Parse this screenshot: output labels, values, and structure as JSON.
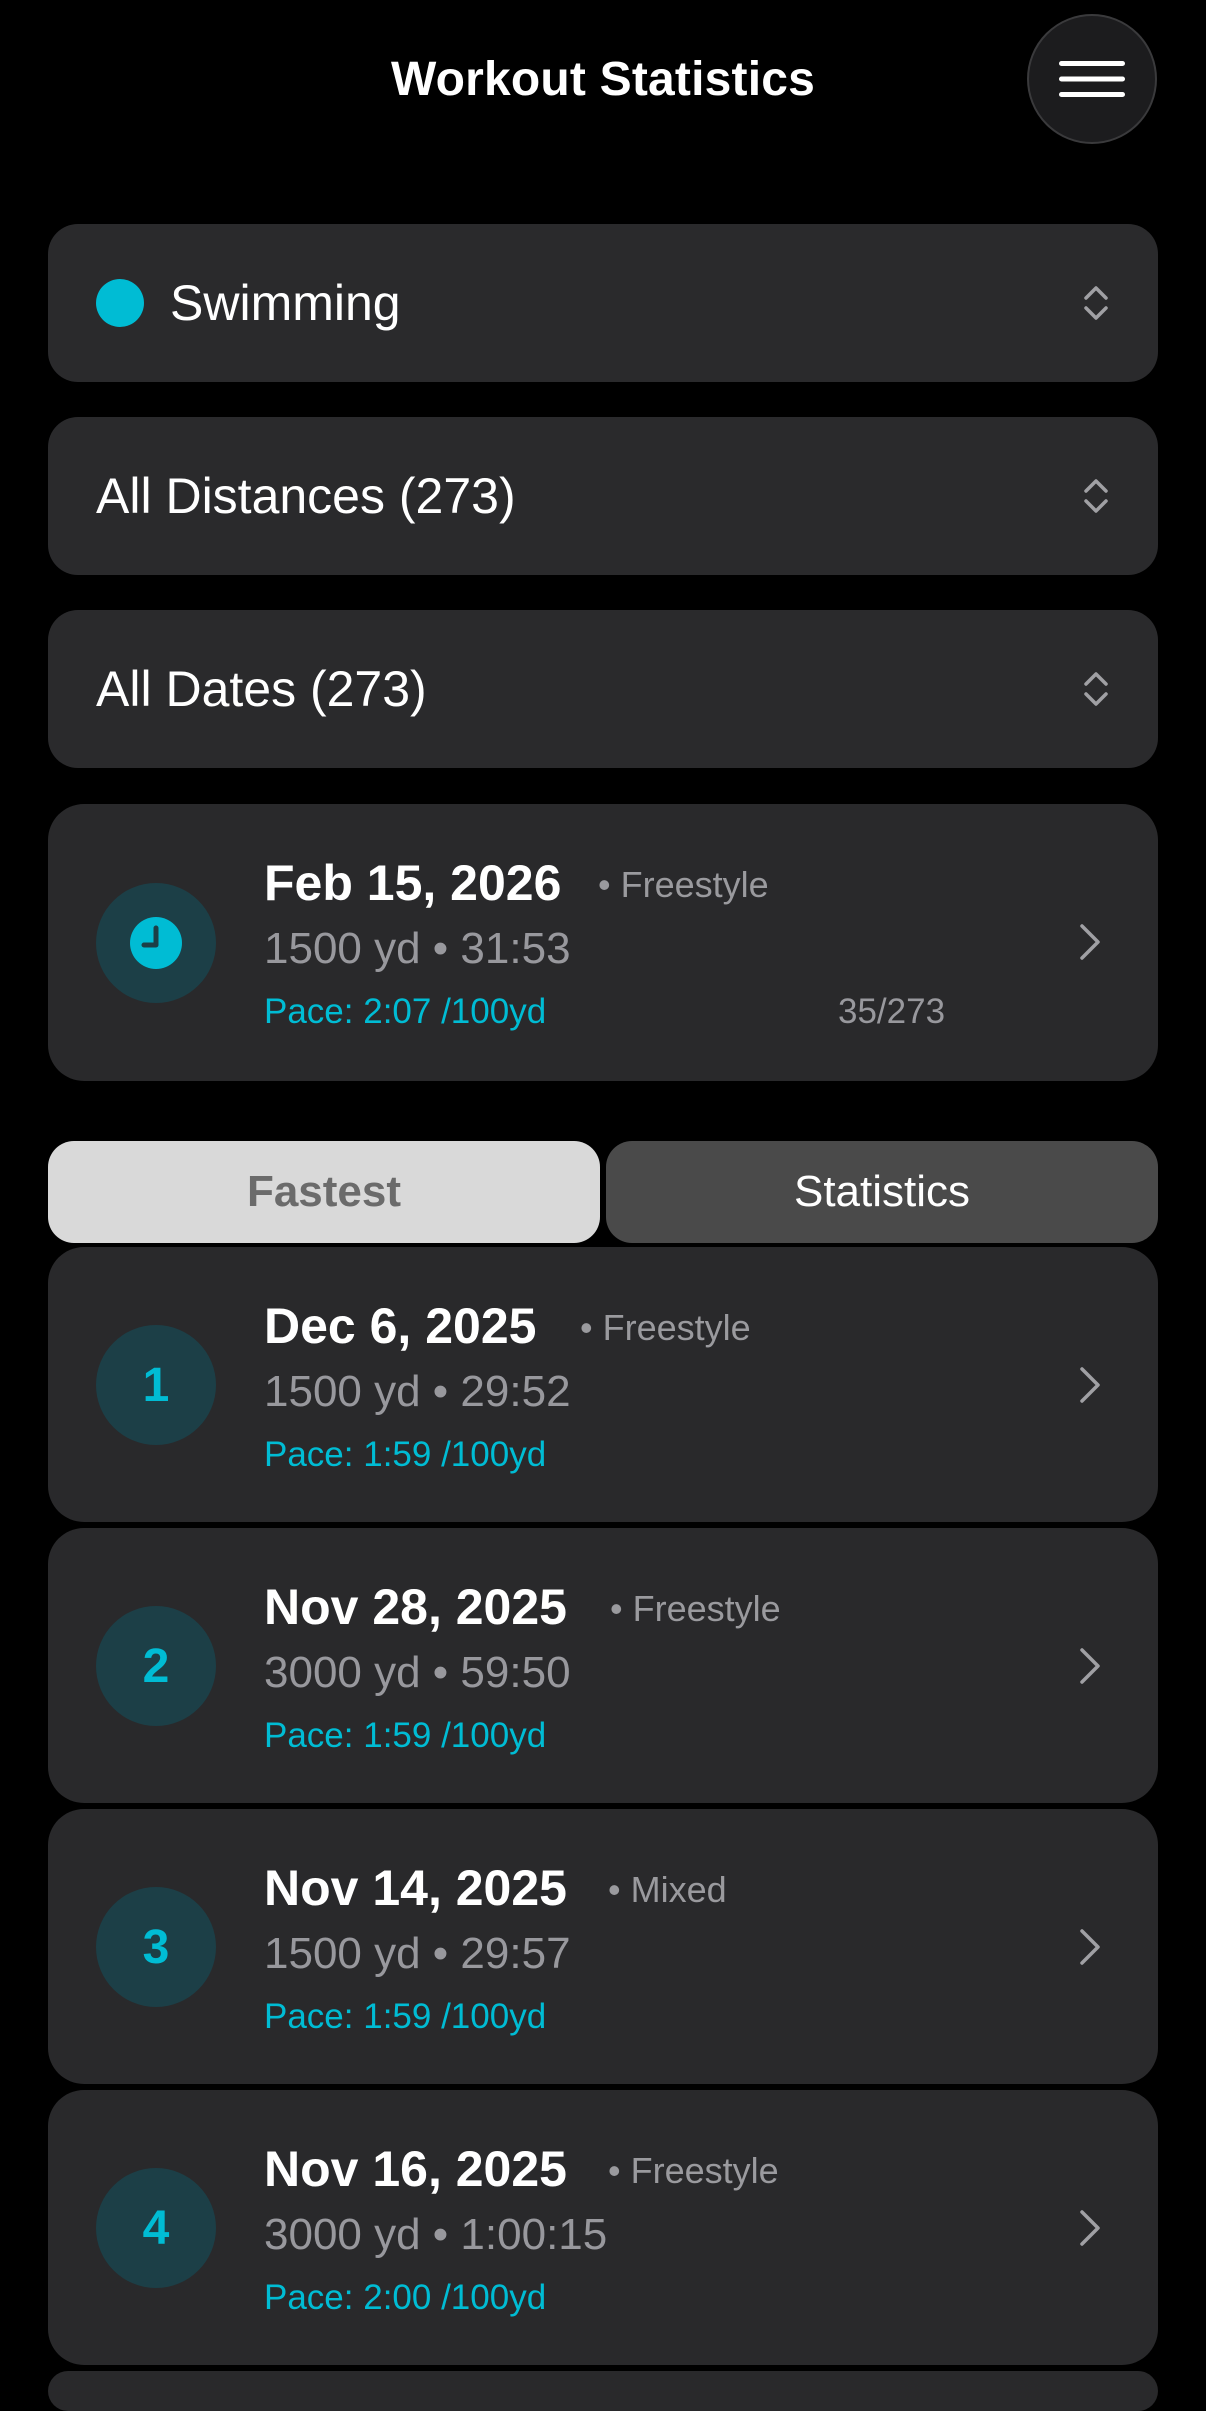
{
  "header": {
    "title": "Workout Statistics",
    "menu_icon": "hamburger-menu-icon"
  },
  "filters": {
    "activity": {
      "label": "Swimming",
      "dot_color": "#00bcd4"
    },
    "distance": {
      "label": "All Distances (273)"
    },
    "dates": {
      "label": "All Dates (273)"
    }
  },
  "latest": {
    "date": "Feb 15, 2026",
    "style": "• Freestyle",
    "stats": "1500 yd • 31:53",
    "pace": "Pace: 2:07 /100yd",
    "count": "35/273",
    "icon": "clock-icon"
  },
  "tabs": {
    "fastest": "Fastest",
    "statistics": "Statistics",
    "selected": "Fastest"
  },
  "fastest_list": [
    {
      "rank": "1",
      "date": "Dec 6, 2025",
      "style": "• Freestyle",
      "stats": "1500 yd • 29:52",
      "pace": "Pace: 1:59 /100yd"
    },
    {
      "rank": "2",
      "date": "Nov 28, 2025",
      "style": "• Freestyle",
      "stats": "3000 yd • 59:50",
      "pace": "Pace: 1:59 /100yd"
    },
    {
      "rank": "3",
      "date": "Nov 14, 2025",
      "style": "• Mixed",
      "stats": "1500 yd • 29:57",
      "pace": "Pace: 1:59 /100yd"
    },
    {
      "rank": "4",
      "date": "Nov 16, 2025",
      "style": "• Freestyle",
      "stats": "3000 yd • 1:00:15",
      "pace": "Pace: 2:00 /100yd"
    }
  ],
  "colors": {
    "accent": "#00bcd4",
    "background": "#000000",
    "card": "#29292b",
    "badge": "#1c3f47"
  }
}
